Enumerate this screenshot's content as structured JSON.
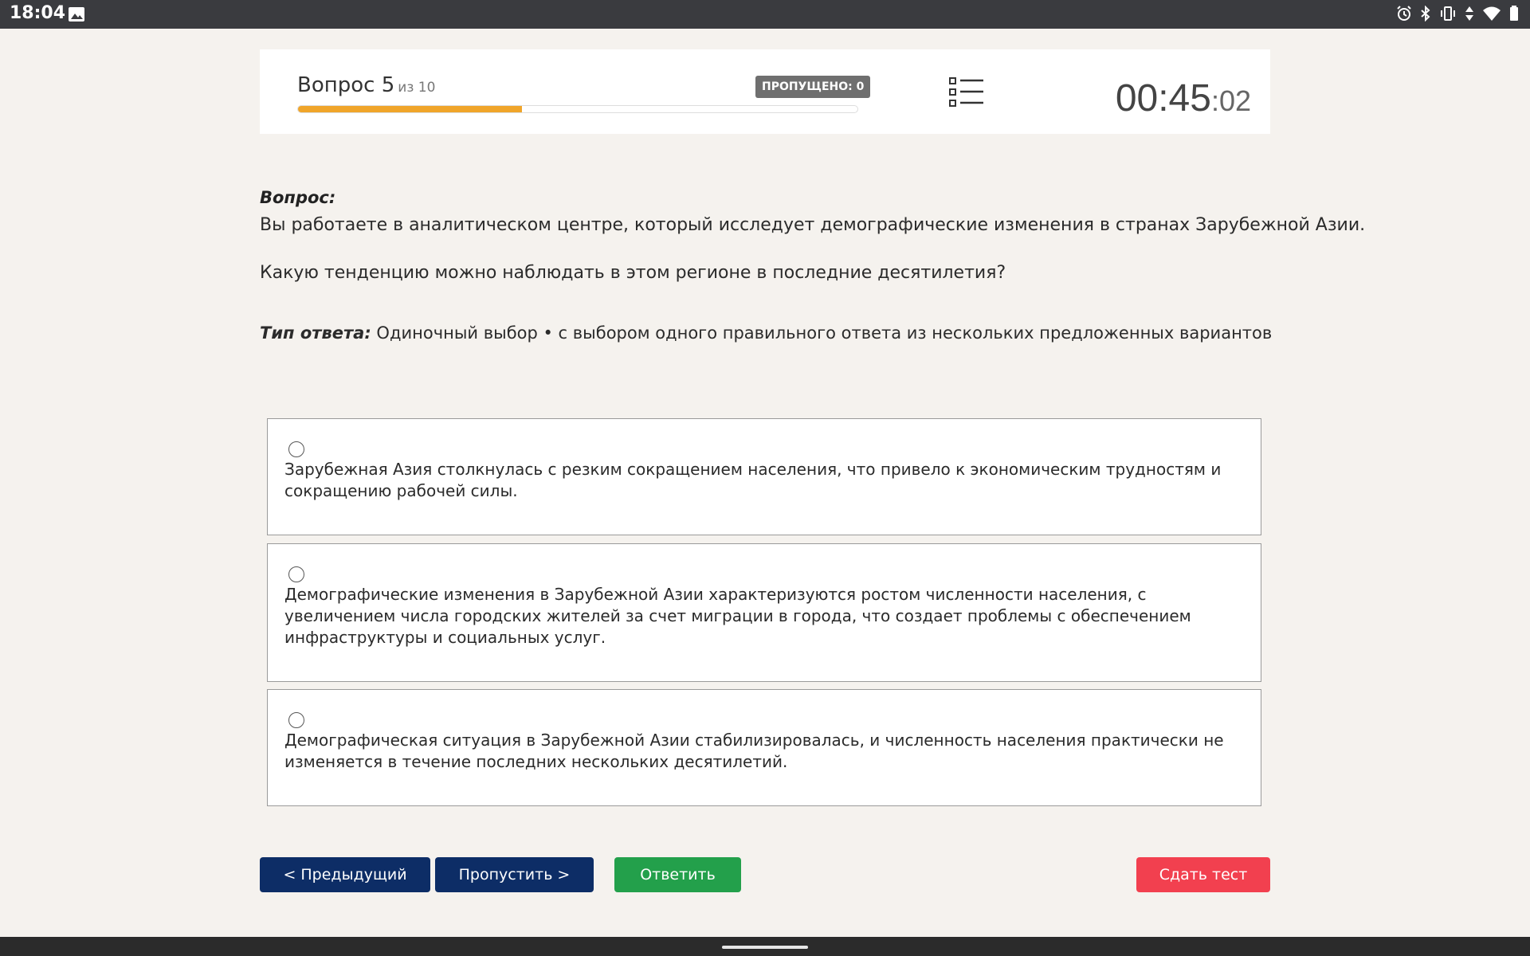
{
  "status_bar": {
    "time": "18:04",
    "icons": [
      "gallery-icon",
      "alarm-icon",
      "bluetooth-icon",
      "vibrate-icon",
      "data-arrows-icon",
      "wifi-icon",
      "battery-icon"
    ]
  },
  "header": {
    "question_label": "Вопрос 5",
    "question_of": "из 10",
    "skipped_badge": "ПРОПУЩЕНО: 0",
    "progress_fraction": 0.4,
    "progress_color": "#f0a52a",
    "timer_main": "00:45",
    "timer_sep": ":",
    "timer_seconds": "02"
  },
  "question": {
    "label": "Вопрос:",
    "line1": "Вы работаете в аналитическом центре, который исследует демографические изменения в странах Зарубежной Азии.",
    "line2": "Какую тенденцию можно наблюдать в этом регионе в последние десятилетия?"
  },
  "answer_type": {
    "label": "Тип ответа:",
    "value": "Одиночный выбор • с выбором одного правильного ответа из нескольких предложенных вариантов"
  },
  "options": [
    {
      "text": "Зарубежная Азия столкнулась с резким сокращением населения, что привело к экономическим трудностям и сокращению рабочей силы.",
      "selected": false
    },
    {
      "text": "Демографические изменения в Зарубежной Азии характеризуются ростом численности населения, с увеличением числа городских жителей за счет миграции в города, что создает проблемы с обеспечением инфраструктуры и социальных услуг.",
      "selected": false
    },
    {
      "text": "Демографическая ситуация в Зарубежной Азии стабилизировалась, и численность населения практически не изменяется в течение последних нескольких десятилетий.",
      "selected": false
    }
  ],
  "buttons": {
    "prev": "< Предыдущий",
    "skip": "Пропустить >",
    "answer": "Ответить",
    "submit": "Сдать тест"
  },
  "colors": {
    "primary_nav": "#0d2d66",
    "answer": "#23a04b",
    "submit": "#f2404f",
    "skipped_badge": "#6f6f6f"
  }
}
